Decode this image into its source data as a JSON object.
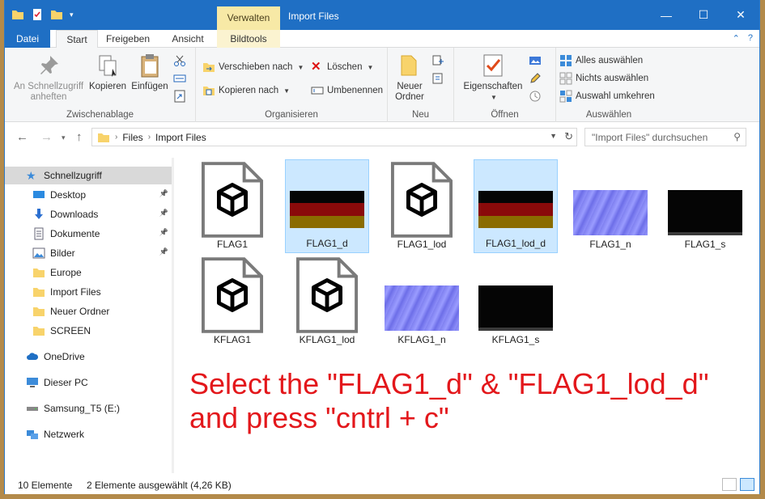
{
  "titlebar": {
    "context_tab": "Verwalten",
    "title": "Import Files",
    "controls": [
      "minimize-icon",
      "maximize-icon",
      "close-icon"
    ]
  },
  "ribbon_tabs": {
    "file": "Datei",
    "start": "Start",
    "share": "Freigeben",
    "view": "Ansicht",
    "picture_tools": "Bildtools"
  },
  "ribbon": {
    "clipboard": {
      "label": "Zwischenablage",
      "pin": "An Schnellzugriff anheften",
      "copy": "Kopieren",
      "paste": "Einfügen"
    },
    "organize": {
      "label": "Organisieren",
      "move_to": "Verschieben nach",
      "copy_to": "Kopieren nach",
      "delete": "Löschen",
      "rename": "Umbenennen"
    },
    "new": {
      "label": "Neu",
      "new_folder": "Neuer Ordner"
    },
    "open": {
      "label": "Öffnen",
      "properties": "Eigenschaften"
    },
    "select": {
      "label": "Auswählen",
      "select_all": "Alles auswählen",
      "select_none": "Nichts auswählen",
      "invert": "Auswahl umkehren"
    }
  },
  "address": {
    "crumbs": [
      "Files",
      "Import Files"
    ],
    "search_placeholder": "\"Import Files\" durchsuchen"
  },
  "nav": {
    "quick_access": "Schnellzugriff",
    "items": [
      {
        "label": "Desktop",
        "icon": "desktop-icon",
        "pinned": true
      },
      {
        "label": "Downloads",
        "icon": "download-icon",
        "pinned": true
      },
      {
        "label": "Dokumente",
        "icon": "documents-icon",
        "pinned": true
      },
      {
        "label": "Bilder",
        "icon": "pictures-icon",
        "pinned": true
      },
      {
        "label": "Europe",
        "icon": "folder-icon",
        "pinned": false
      },
      {
        "label": "Import Files",
        "icon": "folder-icon",
        "pinned": false
      },
      {
        "label": "Neuer Ordner",
        "icon": "folder-icon",
        "pinned": false
      },
      {
        "label": "SCREEN",
        "icon": "folder-icon",
        "pinned": false
      }
    ],
    "onedrive": "OneDrive",
    "this_pc": "Dieser PC",
    "drive": "Samsung_T5 (E:)",
    "network": "Netzwerk"
  },
  "files": [
    {
      "name": "FLAG1",
      "kind": "model",
      "selected": false
    },
    {
      "name": "FLAG1_d",
      "kind": "flag",
      "selected": true
    },
    {
      "name": "FLAG1_lod",
      "kind": "model",
      "selected": false
    },
    {
      "name": "FLAG1_lod_d",
      "kind": "flag",
      "selected": true
    },
    {
      "name": "FLAG1_n",
      "kind": "normal",
      "selected": false
    },
    {
      "name": "FLAG1_s",
      "kind": "spec",
      "selected": false
    },
    {
      "name": "KFLAG1",
      "kind": "model",
      "selected": false
    },
    {
      "name": "KFLAG1_lod",
      "kind": "model",
      "selected": false
    },
    {
      "name": "KFLAG1_n",
      "kind": "normal",
      "selected": false
    },
    {
      "name": "KFLAG1_s",
      "kind": "spec",
      "selected": false
    }
  ],
  "overlay": {
    "line1": "Select the \"FLAG1_d\" & \"FLAG1_lod_d\"",
    "line2": "and press \"cntrl + c\""
  },
  "status": {
    "count": "10 Elemente",
    "selection": "2 Elemente ausgewählt (4,26 KB)"
  },
  "colors": {
    "accent": "#1f6fc4",
    "selection": "#cce8ff",
    "overlay_text": "#e3171b"
  }
}
